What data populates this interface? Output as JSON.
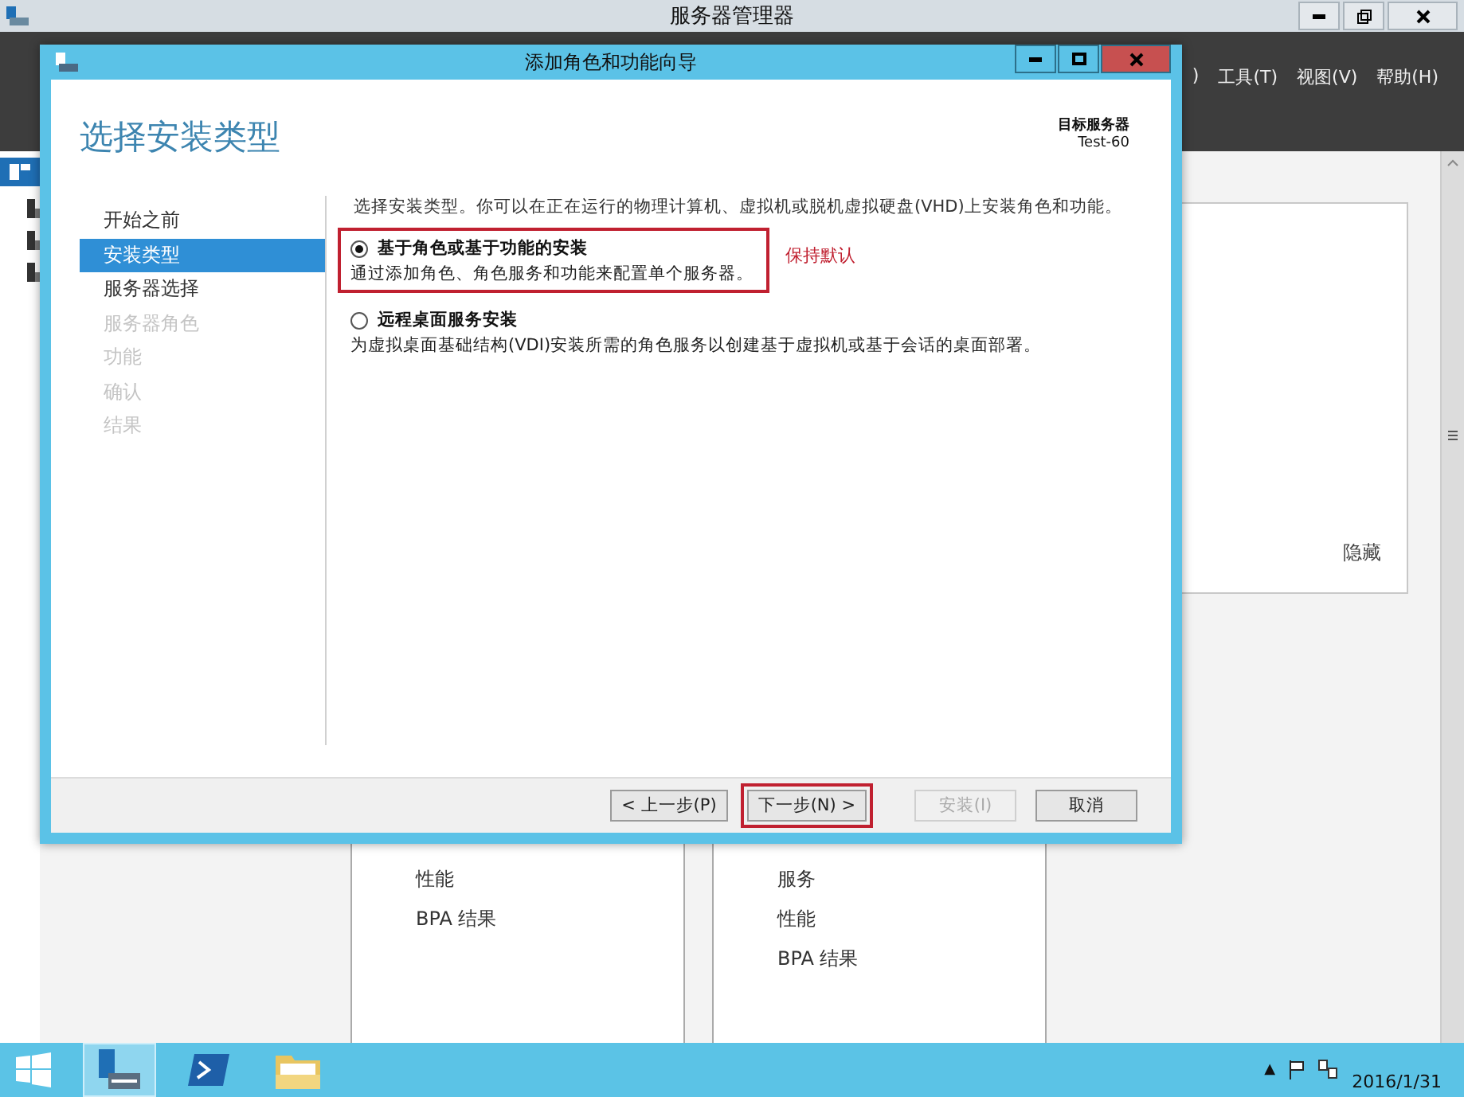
{
  "window": {
    "title": "服务器管理器"
  },
  "menu": [
    ")",
    "工具(T)",
    "视图(V)",
    "帮助(H)"
  ],
  "background_panel": {
    "hide_link": "隐藏"
  },
  "tile_lists": [
    [
      "性能",
      "BPA 结果"
    ],
    [
      "服务",
      "性能",
      "BPA 结果"
    ]
  ],
  "dialog": {
    "title": "添加角色和功能向导",
    "heading": "选择安装类型",
    "target_label": "目标服务器",
    "target_value": "Test-60",
    "steps": [
      {
        "label": "开始之前",
        "selected": false,
        "disabled": false
      },
      {
        "label": "安装类型",
        "selected": true,
        "disabled": false
      },
      {
        "label": "服务器选择",
        "selected": false,
        "disabled": false
      },
      {
        "label": "服务器角色",
        "selected": false,
        "disabled": true
      },
      {
        "label": "功能",
        "selected": false,
        "disabled": true
      },
      {
        "label": "确认",
        "selected": false,
        "disabled": true
      },
      {
        "label": "结果",
        "selected": false,
        "disabled": true
      }
    ],
    "description": "选择安装类型。你可以在正在运行的物理计算机、虚拟机或脱机虚拟硬盘(VHD)上安装角色和功能。",
    "options": [
      {
        "title": "基于角色或基于功能的安装",
        "description": "通过添加角色、角色服务和功能来配置单个服务器。",
        "selected": true,
        "highlighted": true
      },
      {
        "title": "远程桌面服务安装",
        "description": "为虚拟桌面基础结构(VDI)安装所需的角色服务以创建基于虚拟机或基于会话的桌面部署。",
        "selected": false,
        "highlighted": false
      }
    ],
    "annotation": "保持默认",
    "buttons": [
      {
        "label": "< 上一步(P)",
        "disabled": false,
        "highlighted": false
      },
      {
        "label": "下一步(N) >",
        "disabled": false,
        "highlighted": true
      },
      {
        "label": "安装(I)",
        "disabled": true,
        "highlighted": false
      },
      {
        "label": "取消",
        "disabled": false,
        "highlighted": false
      }
    ]
  },
  "taskbar": {
    "apps": [
      {
        "kind": "server-manager",
        "selected": true
      },
      {
        "kind": "powershell",
        "selected": false
      },
      {
        "kind": "file-explorer",
        "selected": false
      }
    ],
    "tray_caret": "▲",
    "date": "2016/1/31"
  }
}
